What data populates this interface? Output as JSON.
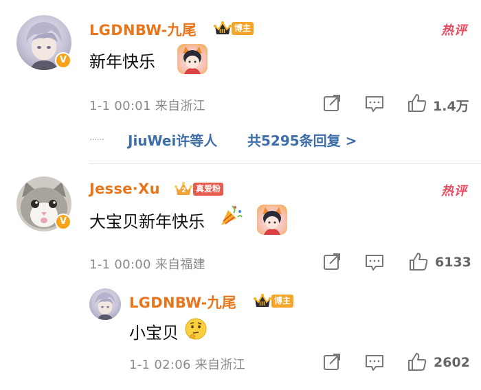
{
  "comments": [
    {
      "username": "LGDNBW-九尾",
      "badge_label": "博主",
      "badge_level": "III",
      "text": "新年快乐",
      "meta": "1-1 00:01 来自浙江",
      "likes": "1.4万",
      "hot_label": "热评",
      "replies_summary": {
        "dots": "······",
        "names": "JiuWei许等人",
        "count_text": "共5295条回复 >"
      }
    },
    {
      "username": "Jesse·Xu",
      "badge_label": "真爱粉",
      "badge_level": "2",
      "text": "大宝贝新年快乐",
      "meta": "1-1 00:00 来自福建",
      "likes": "6133",
      "hot_label": "热评"
    }
  ],
  "reply": {
    "username": "LGDNBW-九尾",
    "badge_label": "博主",
    "badge_level": "III",
    "text": "小宝贝",
    "meta": "1-1 02:06 来自浙江",
    "likes": "2602"
  },
  "icons": {
    "verified": "V",
    "share": "share-icon",
    "comment": "comment-icon",
    "like": "thumbs-up-icon"
  },
  "colors": {
    "username": "#e8751a",
    "hot": "#e84a5f",
    "link": "#3d6ea8",
    "meta": "#8a8a8a"
  }
}
